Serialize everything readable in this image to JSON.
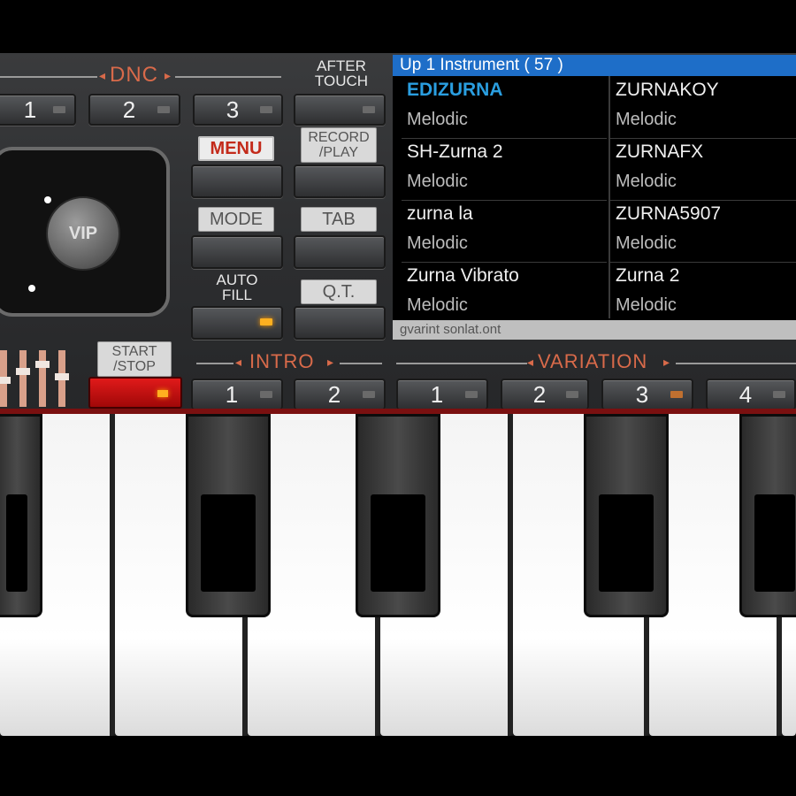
{
  "dnc": {
    "label": "DNC",
    "buttons": [
      "1",
      "2",
      "3"
    ]
  },
  "after_touch": {
    "line1": "AFTER",
    "line2": "TOUCH"
  },
  "menu_label": "MENU",
  "record_play": {
    "line1": "RECORD",
    "line2": "/PLAY"
  },
  "mode_label": "MODE",
  "tab_label": "TAB",
  "auto_fill": {
    "line1": "AUTO",
    "line2": "FILL"
  },
  "qt_label": "Q.T.",
  "joystick_logo": "VIP",
  "start_stop": {
    "line1": "START",
    "line2": "/STOP"
  },
  "intro": {
    "label": "INTRO",
    "buttons": [
      "1",
      "2"
    ]
  },
  "variation": {
    "label": "VARIATION",
    "buttons": [
      "1",
      "2",
      "3",
      "4"
    ]
  },
  "display": {
    "header": "Up 1 Instrument ( 57 )",
    "items": [
      {
        "name": "EDIZURNA",
        "type": "Melodic",
        "selected": true
      },
      {
        "name": "ZURNAKOY",
        "type": "Melodic"
      },
      {
        "name": "SH-Zurna 2",
        "type": "Melodic"
      },
      {
        "name": "ZURNAFX",
        "type": "Melodic"
      },
      {
        "name": "zurna la",
        "type": "Melodic"
      },
      {
        "name": "ZURNA5907",
        "type": "Melodic"
      },
      {
        "name": "Zurna Vibrato",
        "type": "Melodic"
      },
      {
        "name": "Zurna 2",
        "type": "Melodic"
      }
    ],
    "footer": "gvarint sonlat.ont"
  },
  "colors": {
    "accent": "#d86a4a",
    "header_blue": "#1e6ec8",
    "selected_text": "#2a9ee0",
    "start_red": "#e01a1a",
    "led": "#ffb020"
  }
}
